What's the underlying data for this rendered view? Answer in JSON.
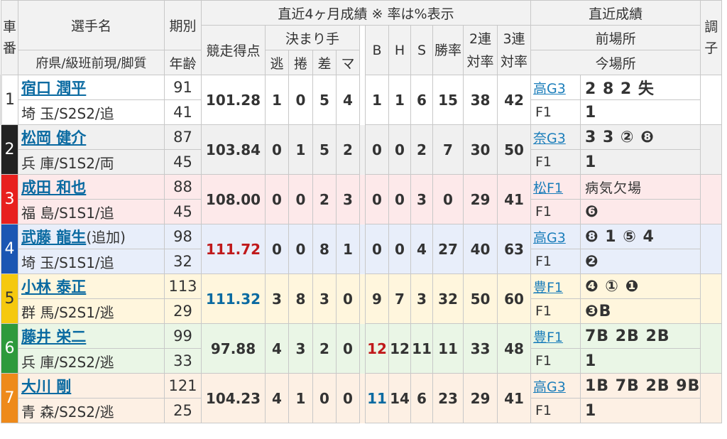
{
  "header": {
    "car_no": "車番",
    "racer_name": "選手名",
    "racer_sub": "府県/級班前現/脚質",
    "term": "期別",
    "age": "年齢",
    "recent4": "直近4ヶ月成績 ※ 率は%表示",
    "score": "競走得点",
    "kimarite": "決まり手",
    "nige": "逃",
    "makuri": "捲",
    "sashi": "差",
    "mark": "マ",
    "b": "B",
    "h": "H",
    "s": "S",
    "win": "勝率",
    "q2": "2連対率",
    "q3": "3連対率",
    "recent": "直近成績",
    "prev_venue": "前場所",
    "this_venue": "今場所",
    "condition": "調子"
  },
  "racers": [
    {
      "car": "1",
      "name": "宿口 潤平",
      "extra": "",
      "info": "埼 玉/S2S2/追",
      "term": "91",
      "age": "41",
      "score": "101.28",
      "nige": "1",
      "makuri": "0",
      "sashi": "5",
      "mark": "4",
      "b": "1",
      "h": "1",
      "s": "6",
      "win": "15",
      "q2": "38",
      "q3": "42",
      "prev_venue": "高G3",
      "prev_results": "2 8 2 失",
      "this_venue": "F1",
      "this_results": "1"
    },
    {
      "car": "2",
      "name": "松岡 健介",
      "extra": "",
      "info": "兵 庫/S1S2/両",
      "term": "87",
      "age": "45",
      "score": "103.84",
      "nige": "0",
      "makuri": "1",
      "sashi": "5",
      "mark": "2",
      "b": "0",
      "h": "0",
      "s": "2",
      "win": "7",
      "q2": "30",
      "q3": "50",
      "prev_venue": "奈G3",
      "prev_results": "3 3 ② ❽",
      "this_venue": "F1",
      "this_results": "1"
    },
    {
      "car": "3",
      "name": "成田 和也",
      "extra": "",
      "info": "福 島/S1S1/追",
      "term": "88",
      "age": "45",
      "score": "108.00",
      "nige": "0",
      "makuri": "0",
      "sashi": "2",
      "mark": "3",
      "b": "0",
      "h": "0",
      "s": "3",
      "win": "0",
      "q2": "29",
      "q3": "41",
      "prev_venue": "松F1",
      "prev_results": "病気欠場",
      "this_venue": "F1",
      "this_results": "❻"
    },
    {
      "car": "4",
      "name": "武藤 龍生",
      "extra": "(追加)",
      "info": "埼 玉/S1S1/追",
      "term": "98",
      "age": "32",
      "score": "111.72",
      "nige": "0",
      "makuri": "0",
      "sashi": "8",
      "mark": "1",
      "b": "0",
      "h": "0",
      "s": "4",
      "win": "27",
      "q2": "40",
      "q3": "63",
      "prev_venue": "高G3",
      "prev_results": "❽ 1 ⑤ 4",
      "this_venue": "F1",
      "this_results": "❷"
    },
    {
      "car": "5",
      "name": "小林 泰正",
      "extra": "",
      "info": "群 馬/S2S1/逃",
      "term": "113",
      "age": "29",
      "score": "111.32",
      "nige": "3",
      "makuri": "8",
      "sashi": "3",
      "mark": "0",
      "b": "9",
      "h": "7",
      "s": "3",
      "win": "32",
      "q2": "50",
      "q3": "60",
      "prev_venue": "豊F1",
      "prev_results": "❹ ① ❶",
      "this_venue": "F1",
      "this_results": "❸B"
    },
    {
      "car": "6",
      "name": "藤井 栄二",
      "extra": "",
      "info": "兵 庫/S2S2/逃",
      "term": "99",
      "age": "33",
      "score": "97.88",
      "nige": "4",
      "makuri": "3",
      "sashi": "2",
      "mark": "0",
      "b": "12",
      "h": "12",
      "s": "11",
      "win": "11",
      "q2": "33",
      "q3": "48",
      "prev_venue": "豊F1",
      "prev_results": "7B 2B 2B",
      "this_venue": "F1",
      "this_results": "1"
    },
    {
      "car": "7",
      "name": "大川 剛",
      "extra": "",
      "info": "青 森/S2S2/逃",
      "term": "121",
      "age": "25",
      "score": "104.23",
      "nige": "4",
      "makuri": "1",
      "sashi": "0",
      "mark": "0",
      "b": "11",
      "h": "14",
      "s": "6",
      "win": "23",
      "q2": "29",
      "q3": "41",
      "prev_venue": "高G3",
      "prev_results": "1B 7B 2B 9B",
      "this_venue": "F1",
      "this_results": "1"
    }
  ],
  "colors": {
    "score_red": "#c0191b",
    "score_blue": "#0a6aa1",
    "link": "#0a6aa1"
  }
}
